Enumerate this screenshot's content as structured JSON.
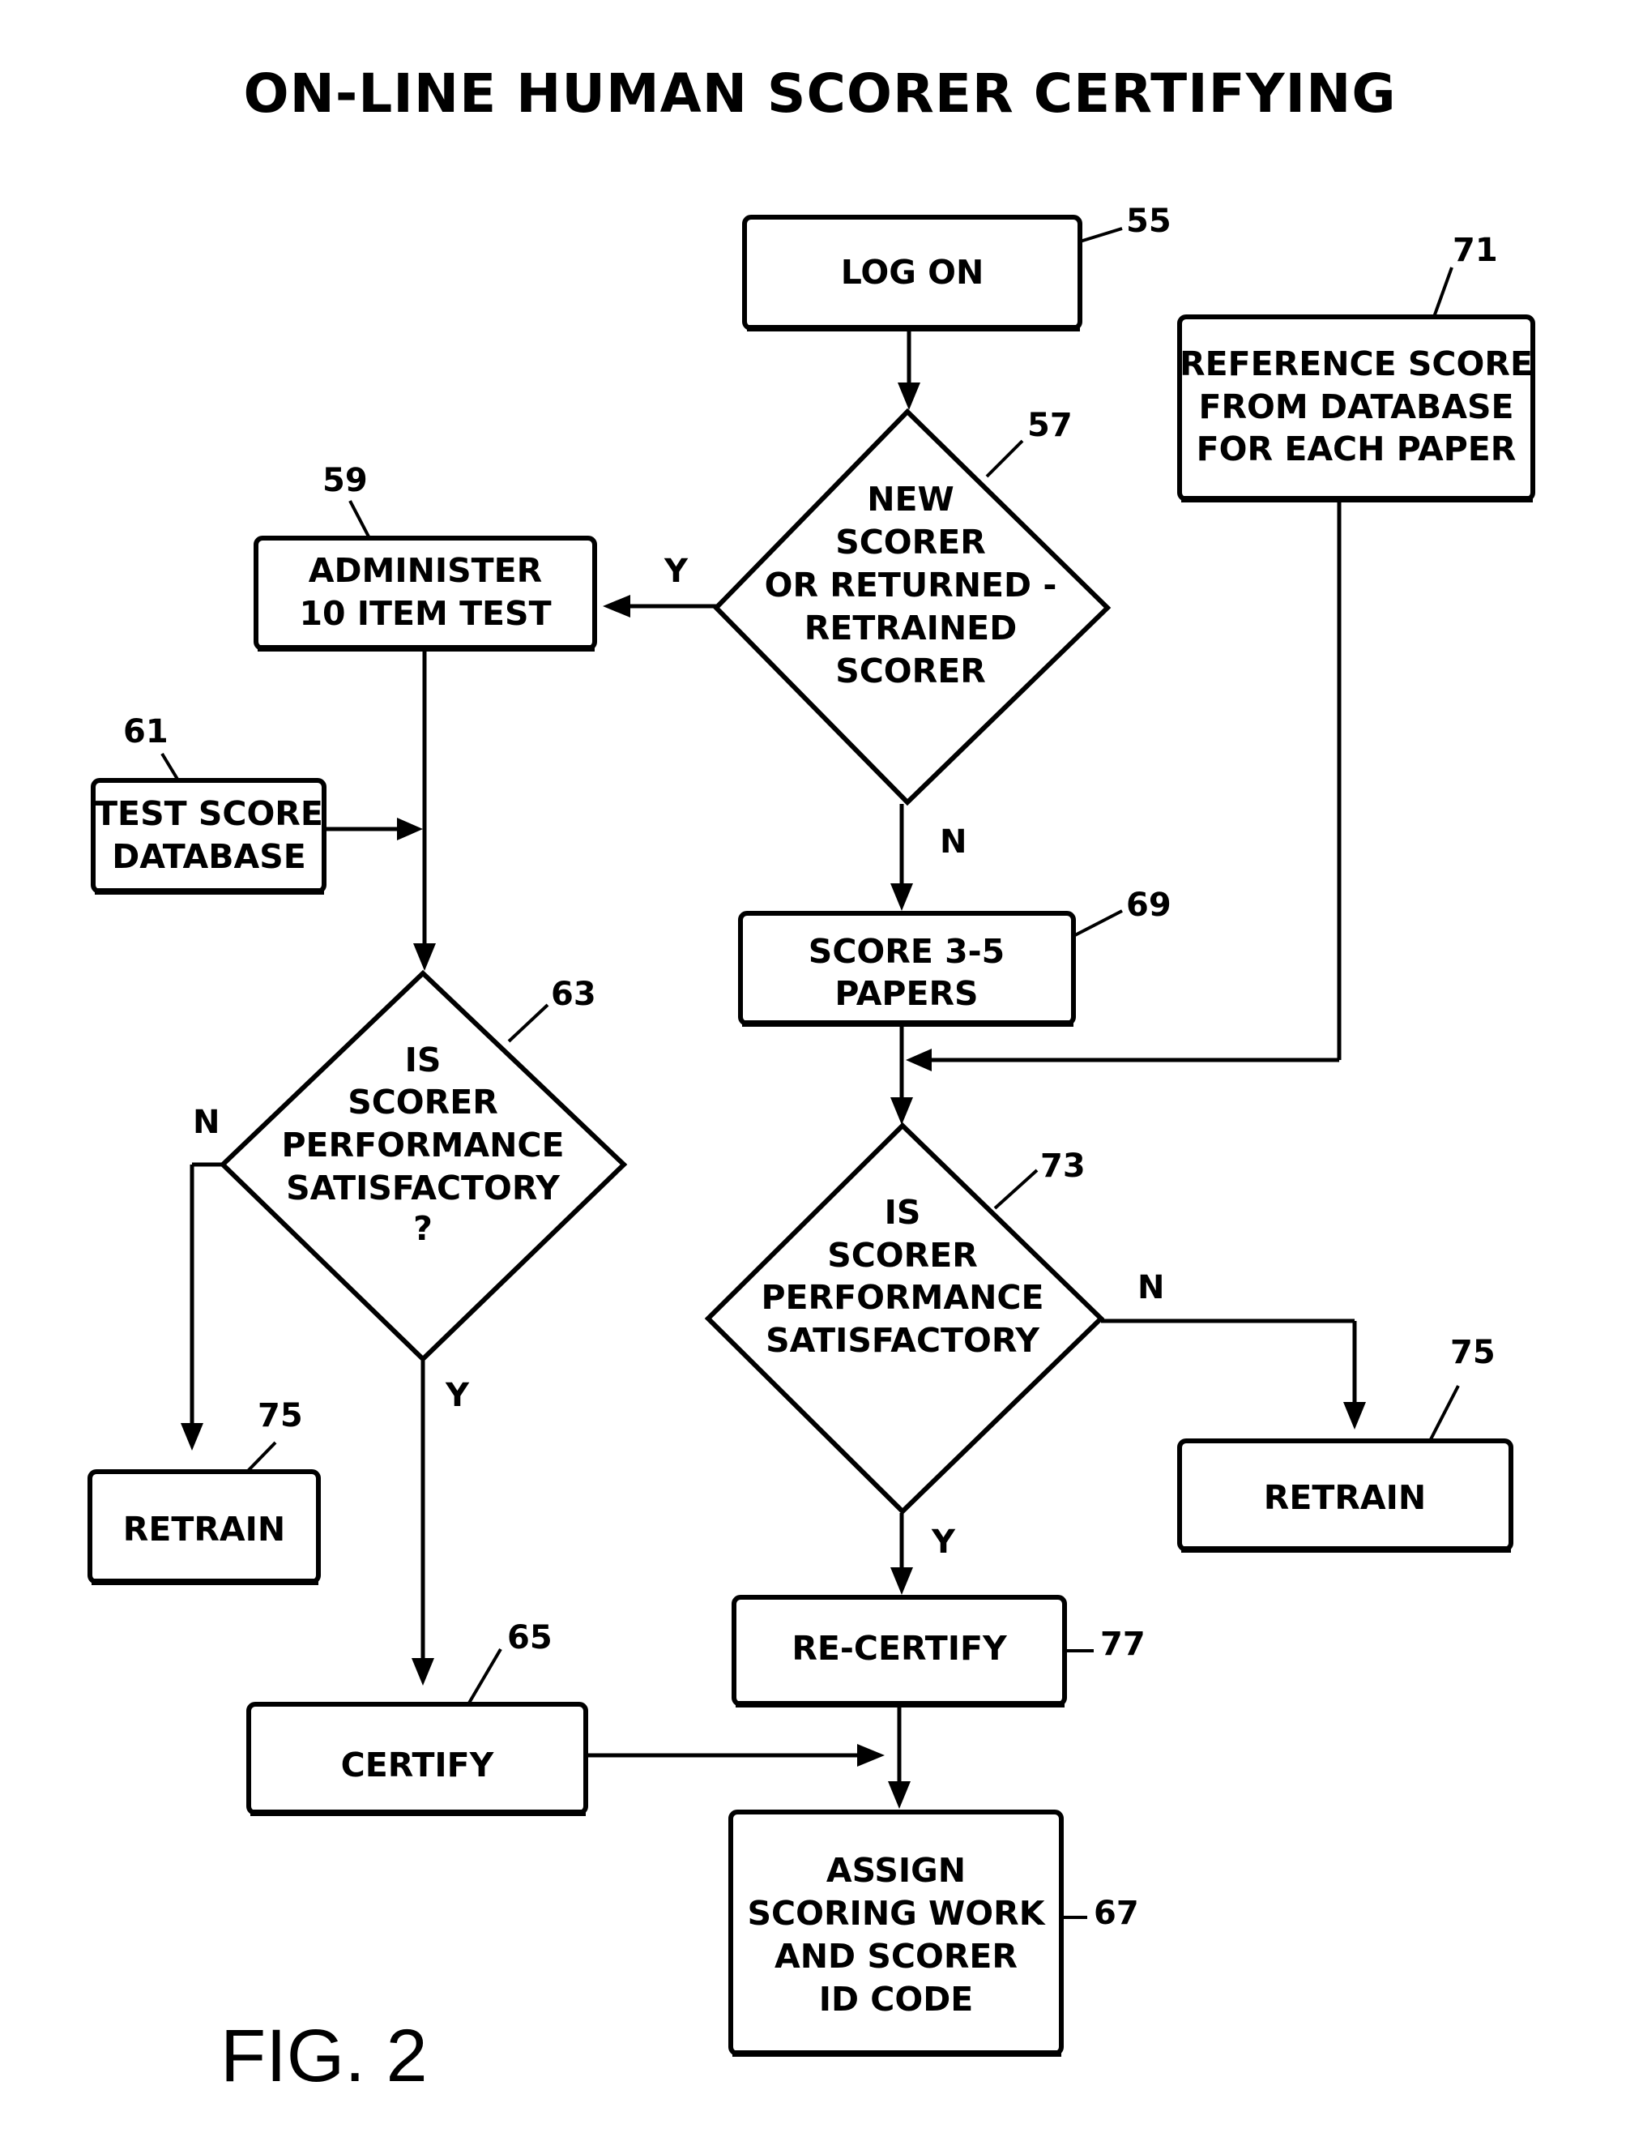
{
  "title": "ON-LINE HUMAN SCORER CERTIFYING",
  "figure_label": "FIG. 2",
  "nodes": {
    "log_on": {
      "ref": "55",
      "lines": [
        "LOG ON"
      ]
    },
    "new_scorer": {
      "ref": "57",
      "lines": [
        "NEW",
        "SCORER",
        "OR RETURNED -",
        "RETRAINED",
        "SCORER"
      ]
    },
    "administer": {
      "ref": "59",
      "lines": [
        "ADMINISTER",
        "10 ITEM TEST"
      ]
    },
    "test_db": {
      "ref": "61",
      "lines": [
        "TEST SCORE",
        "DATABASE"
      ]
    },
    "perf_63": {
      "ref": "63",
      "lines": [
        "IS",
        "SCORER",
        "PERFORMANCE",
        "SATISFACTORY",
        "?"
      ]
    },
    "certify": {
      "ref": "65",
      "lines": [
        "CERTIFY"
      ]
    },
    "assign": {
      "ref": "67",
      "lines": [
        "ASSIGN",
        "SCORING WORK",
        "AND SCORER",
        "ID CODE"
      ]
    },
    "score_papers": {
      "ref": "69",
      "lines": [
        "SCORE 3-5",
        "PAPERS"
      ]
    },
    "reference": {
      "ref": "71",
      "lines": [
        "REFERENCE SCORE",
        "FROM DATABASE",
        "FOR EACH PAPER"
      ]
    },
    "perf_73": {
      "ref": "73",
      "lines": [
        "IS",
        "SCORER",
        "PERFORMANCE",
        "SATISFACTORY"
      ]
    },
    "retrain_left": {
      "ref": "75",
      "lines": [
        "RETRAIN"
      ]
    },
    "retrain_right": {
      "ref": "75",
      "lines": [
        "RETRAIN"
      ]
    },
    "recertify": {
      "ref": "77",
      "lines": [
        "RE-CERTIFY"
      ]
    }
  },
  "edge_labels": {
    "new_yes": "Y",
    "new_no": "N",
    "perf63_no": "N",
    "perf63_yes": "Y",
    "perf73_no": "N",
    "perf73_yes": "Y"
  }
}
